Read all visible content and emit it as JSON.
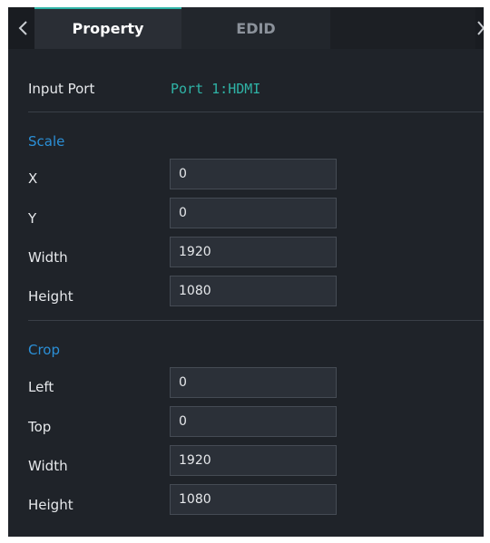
{
  "tabs": {
    "property": "Property",
    "edid": "EDID"
  },
  "input_port": {
    "label": "Input Port",
    "value": "Port 1:HDMI"
  },
  "scale": {
    "title": "Scale",
    "x": {
      "label": "X",
      "value": "0"
    },
    "y": {
      "label": "Y",
      "value": "0"
    },
    "width": {
      "label": "Width",
      "value": "1920"
    },
    "height": {
      "label": "Height",
      "value": "1080"
    }
  },
  "crop": {
    "title": "Crop",
    "left": {
      "label": "Left",
      "value": "0"
    },
    "top": {
      "label": "Top",
      "value": "0"
    },
    "width": {
      "label": "Width",
      "value": "1920"
    },
    "height": {
      "label": "Height",
      "value": "1080"
    }
  },
  "colors": {
    "panel_bg": "#1f2329",
    "accent_teal": "#2fb3a6",
    "section_blue": "#2b8fd6"
  },
  "icons": {
    "back": "chevron-left-icon",
    "next": "chevron-right-icon"
  }
}
